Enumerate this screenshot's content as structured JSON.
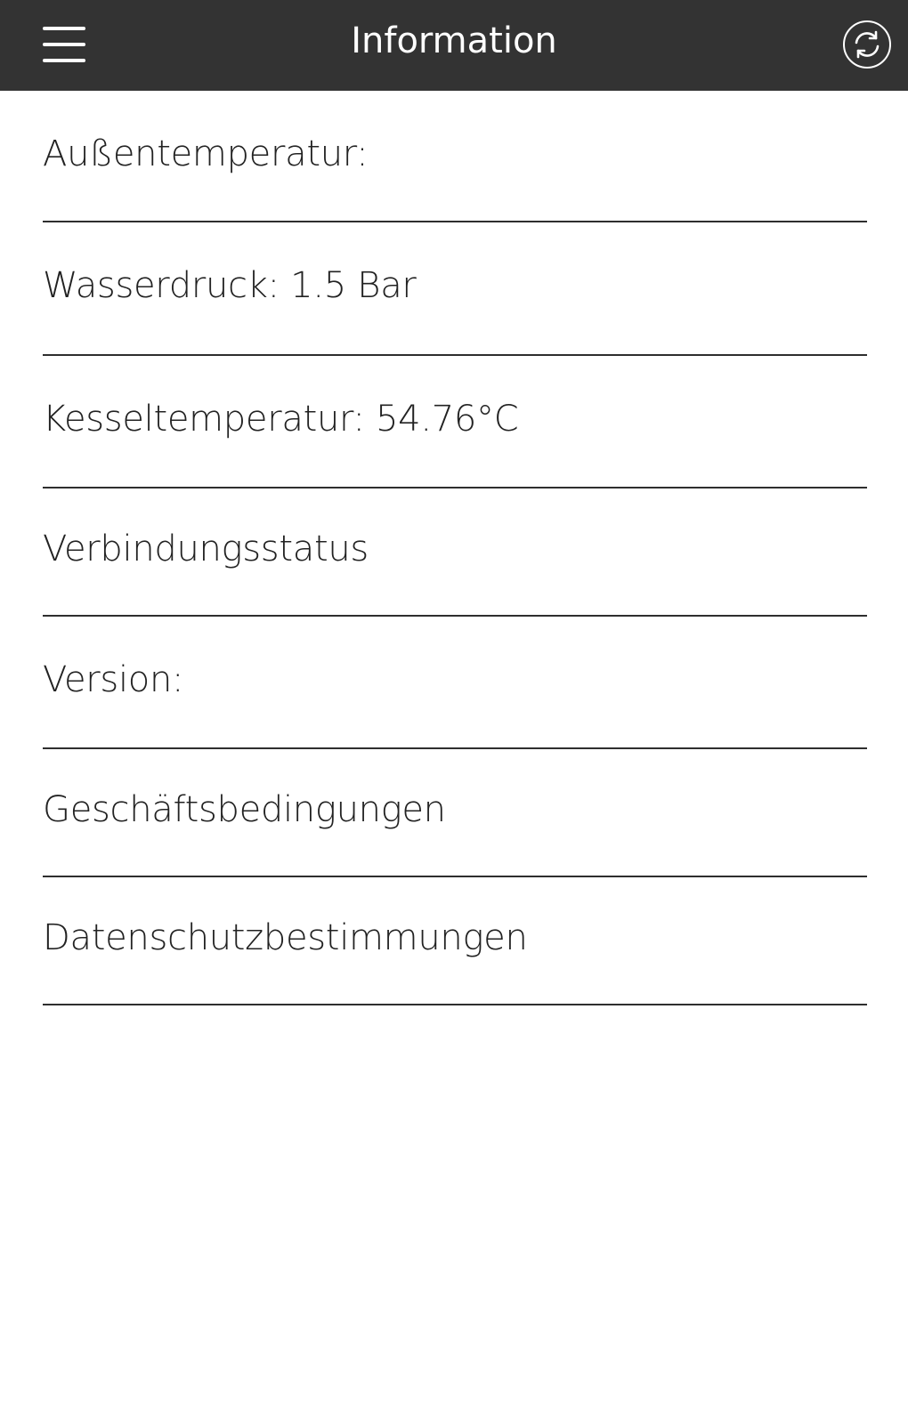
{
  "header": {
    "title": "Information",
    "menu_icon": "hamburger-menu-icon",
    "refresh_icon": "refresh-icon",
    "background_color": "#333333",
    "text_color": "#ffffff"
  },
  "info_list": {
    "items": [
      {
        "label": "Außentemperatur:"
      },
      {
        "label": "Wasserdruck: 1.5 Bar"
      },
      {
        "label": "Kesseltemperatur: 54.76°C"
      },
      {
        "label": "Verbindungsstatus"
      },
      {
        "label": "Version:"
      },
      {
        "label": "Geschäftsbedingungen"
      },
      {
        "label": "Datenschutzbestimmungen"
      }
    ]
  }
}
